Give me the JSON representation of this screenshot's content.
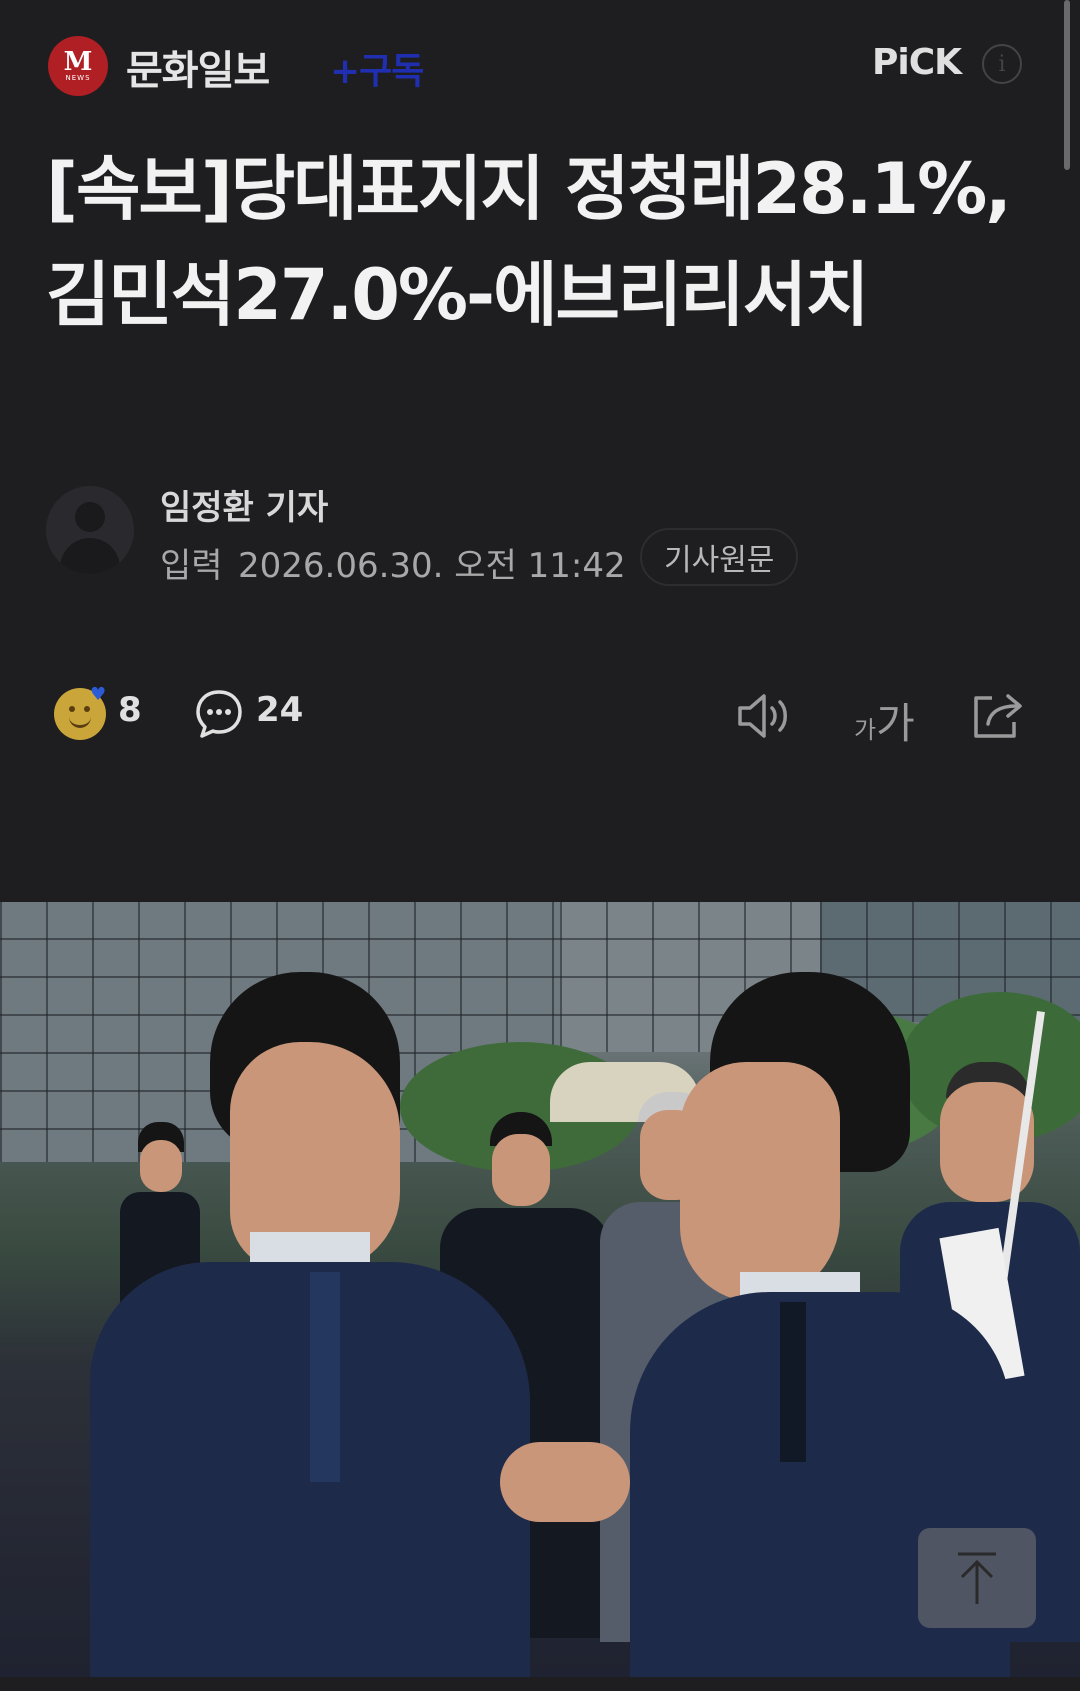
{
  "header": {
    "press_logo_text": "M",
    "press_logo_sub": "NEWS",
    "press_name": "문화일보",
    "subscribe_label": "+구독",
    "pick_label": "PiCK",
    "info_label": "i"
  },
  "article": {
    "headline": "[속보]당대표지지 정청래28.1%, 김민석27.0%-에브리리서치",
    "reporter": "임정환 기자",
    "date_label": "입력",
    "date_value": "2026.06.30. 오전 11:42",
    "original_label": "기사원문"
  },
  "actions": {
    "reaction_count": "8",
    "comment_count": "24"
  },
  "font_size": {
    "small": "가",
    "big": "가"
  },
  "colors": {
    "background": "#1e1e20",
    "subscribe": "#1f2fb0",
    "logo": "#b01f24"
  }
}
